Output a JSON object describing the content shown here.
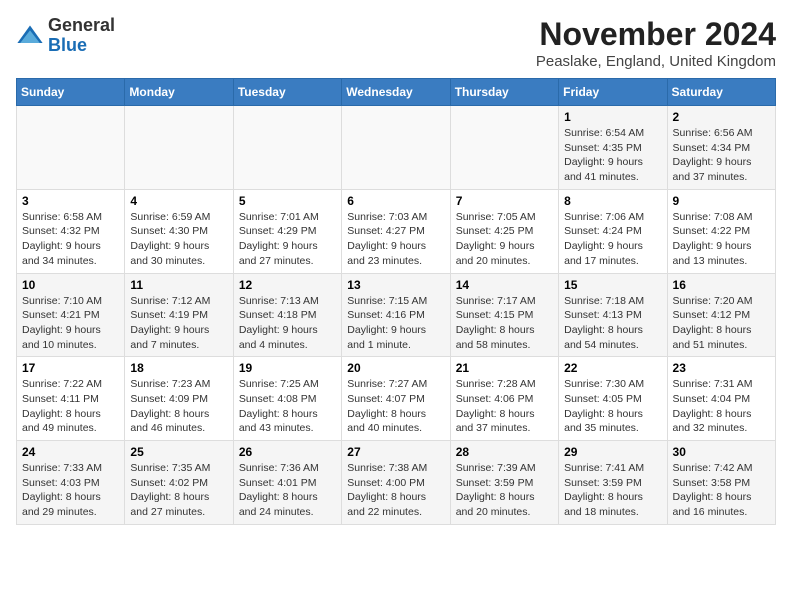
{
  "logo": {
    "general": "General",
    "blue": "Blue"
  },
  "header": {
    "month": "November 2024",
    "location": "Peaslake, England, United Kingdom"
  },
  "columns": [
    "Sunday",
    "Monday",
    "Tuesday",
    "Wednesday",
    "Thursday",
    "Friday",
    "Saturday"
  ],
  "weeks": [
    [
      {
        "day": "",
        "info": ""
      },
      {
        "day": "",
        "info": ""
      },
      {
        "day": "",
        "info": ""
      },
      {
        "day": "",
        "info": ""
      },
      {
        "day": "",
        "info": ""
      },
      {
        "day": "1",
        "info": "Sunrise: 6:54 AM\nSunset: 4:35 PM\nDaylight: 9 hours and 41 minutes."
      },
      {
        "day": "2",
        "info": "Sunrise: 6:56 AM\nSunset: 4:34 PM\nDaylight: 9 hours and 37 minutes."
      }
    ],
    [
      {
        "day": "3",
        "info": "Sunrise: 6:58 AM\nSunset: 4:32 PM\nDaylight: 9 hours and 34 minutes."
      },
      {
        "day": "4",
        "info": "Sunrise: 6:59 AM\nSunset: 4:30 PM\nDaylight: 9 hours and 30 minutes."
      },
      {
        "day": "5",
        "info": "Sunrise: 7:01 AM\nSunset: 4:29 PM\nDaylight: 9 hours and 27 minutes."
      },
      {
        "day": "6",
        "info": "Sunrise: 7:03 AM\nSunset: 4:27 PM\nDaylight: 9 hours and 23 minutes."
      },
      {
        "day": "7",
        "info": "Sunrise: 7:05 AM\nSunset: 4:25 PM\nDaylight: 9 hours and 20 minutes."
      },
      {
        "day": "8",
        "info": "Sunrise: 7:06 AM\nSunset: 4:24 PM\nDaylight: 9 hours and 17 minutes."
      },
      {
        "day": "9",
        "info": "Sunrise: 7:08 AM\nSunset: 4:22 PM\nDaylight: 9 hours and 13 minutes."
      }
    ],
    [
      {
        "day": "10",
        "info": "Sunrise: 7:10 AM\nSunset: 4:21 PM\nDaylight: 9 hours and 10 minutes."
      },
      {
        "day": "11",
        "info": "Sunrise: 7:12 AM\nSunset: 4:19 PM\nDaylight: 9 hours and 7 minutes."
      },
      {
        "day": "12",
        "info": "Sunrise: 7:13 AM\nSunset: 4:18 PM\nDaylight: 9 hours and 4 minutes."
      },
      {
        "day": "13",
        "info": "Sunrise: 7:15 AM\nSunset: 4:16 PM\nDaylight: 9 hours and 1 minute."
      },
      {
        "day": "14",
        "info": "Sunrise: 7:17 AM\nSunset: 4:15 PM\nDaylight: 8 hours and 58 minutes."
      },
      {
        "day": "15",
        "info": "Sunrise: 7:18 AM\nSunset: 4:13 PM\nDaylight: 8 hours and 54 minutes."
      },
      {
        "day": "16",
        "info": "Sunrise: 7:20 AM\nSunset: 4:12 PM\nDaylight: 8 hours and 51 minutes."
      }
    ],
    [
      {
        "day": "17",
        "info": "Sunrise: 7:22 AM\nSunset: 4:11 PM\nDaylight: 8 hours and 49 minutes."
      },
      {
        "day": "18",
        "info": "Sunrise: 7:23 AM\nSunset: 4:09 PM\nDaylight: 8 hours and 46 minutes."
      },
      {
        "day": "19",
        "info": "Sunrise: 7:25 AM\nSunset: 4:08 PM\nDaylight: 8 hours and 43 minutes."
      },
      {
        "day": "20",
        "info": "Sunrise: 7:27 AM\nSunset: 4:07 PM\nDaylight: 8 hours and 40 minutes."
      },
      {
        "day": "21",
        "info": "Sunrise: 7:28 AM\nSunset: 4:06 PM\nDaylight: 8 hours and 37 minutes."
      },
      {
        "day": "22",
        "info": "Sunrise: 7:30 AM\nSunset: 4:05 PM\nDaylight: 8 hours and 35 minutes."
      },
      {
        "day": "23",
        "info": "Sunrise: 7:31 AM\nSunset: 4:04 PM\nDaylight: 8 hours and 32 minutes."
      }
    ],
    [
      {
        "day": "24",
        "info": "Sunrise: 7:33 AM\nSunset: 4:03 PM\nDaylight: 8 hours and 29 minutes."
      },
      {
        "day": "25",
        "info": "Sunrise: 7:35 AM\nSunset: 4:02 PM\nDaylight: 8 hours and 27 minutes."
      },
      {
        "day": "26",
        "info": "Sunrise: 7:36 AM\nSunset: 4:01 PM\nDaylight: 8 hours and 24 minutes."
      },
      {
        "day": "27",
        "info": "Sunrise: 7:38 AM\nSunset: 4:00 PM\nDaylight: 8 hours and 22 minutes."
      },
      {
        "day": "28",
        "info": "Sunrise: 7:39 AM\nSunset: 3:59 PM\nDaylight: 8 hours and 20 minutes."
      },
      {
        "day": "29",
        "info": "Sunrise: 7:41 AM\nSunset: 3:59 PM\nDaylight: 8 hours and 18 minutes."
      },
      {
        "day": "30",
        "info": "Sunrise: 7:42 AM\nSunset: 3:58 PM\nDaylight: 8 hours and 16 minutes."
      }
    ]
  ]
}
